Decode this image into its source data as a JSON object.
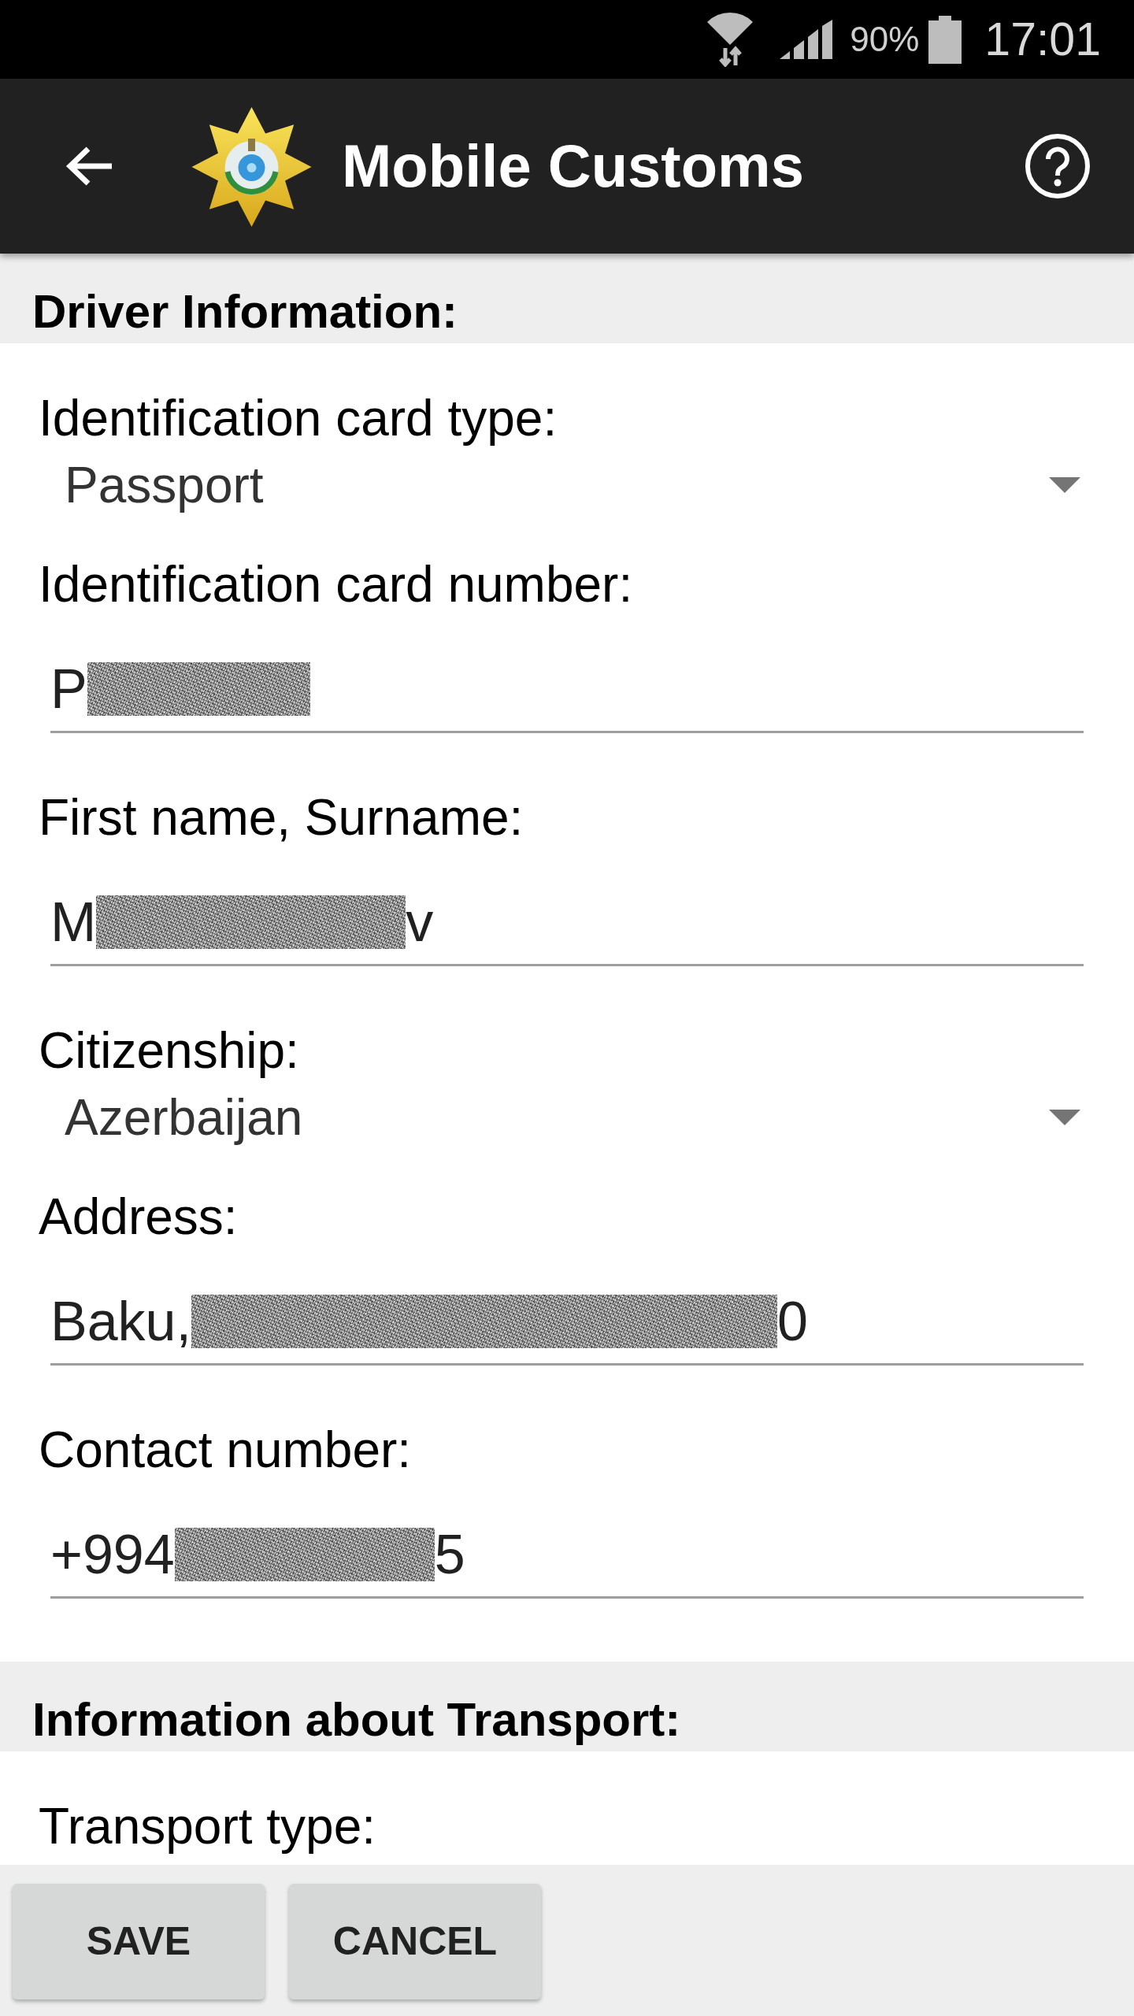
{
  "status_bar": {
    "battery": "90%",
    "time": "17:01"
  },
  "app_bar": {
    "title": "Mobile Customs"
  },
  "sections": [
    {
      "title": "Driver Information:",
      "fields": [
        {
          "kind": "dropdown",
          "label": "Identification card type:",
          "value": "Passport"
        },
        {
          "kind": "text",
          "label": "Identification card number:",
          "value_start": "P",
          "redacted": true
        },
        {
          "kind": "text",
          "label": "First name, Surname:",
          "value_start": "M",
          "redacted": true,
          "value_end": "v"
        },
        {
          "kind": "dropdown",
          "label": "Citizenship:",
          "value": "Azerbaijan"
        },
        {
          "kind": "text",
          "label": "Address:",
          "value_start": "Baku,",
          "redacted": true,
          "value_end": "0"
        },
        {
          "kind": "text",
          "label": "Contact number:",
          "value_start": "+994",
          "redacted": true,
          "value_end": "5"
        }
      ]
    },
    {
      "title": "Information about Transport:",
      "fields": [
        {
          "kind": "label",
          "label": "Transport type:"
        }
      ]
    }
  ],
  "buttons": [
    {
      "label": "SAVE"
    },
    {
      "label": "CANCEL"
    }
  ]
}
